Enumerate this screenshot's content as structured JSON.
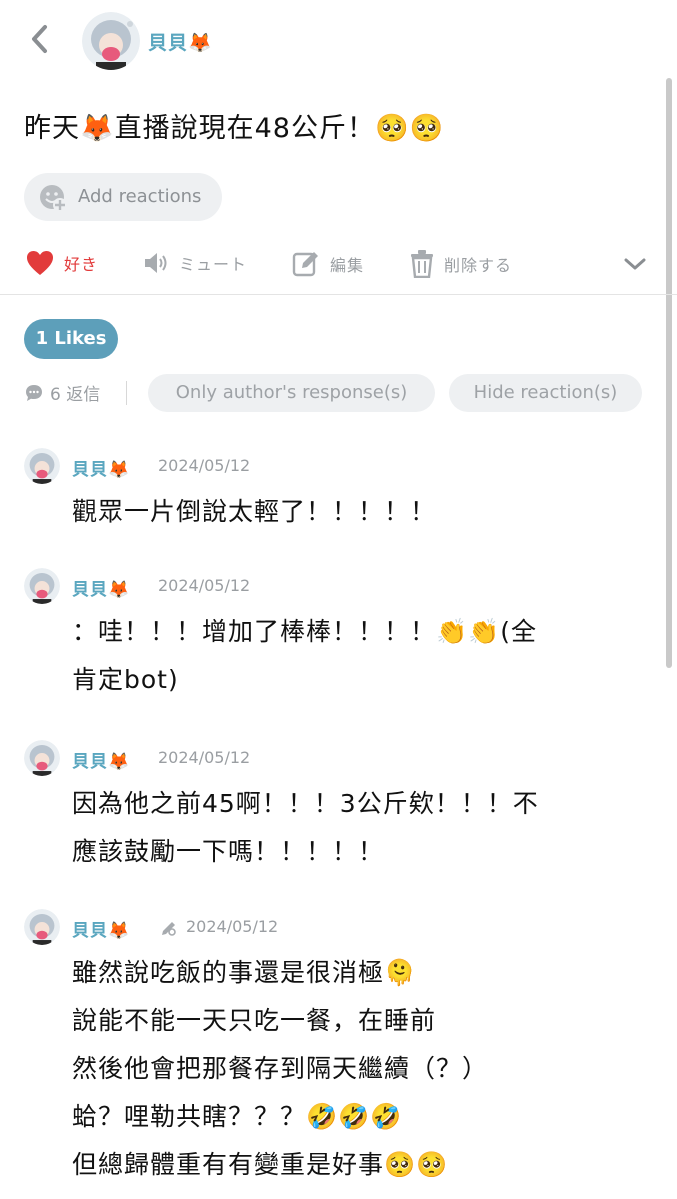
{
  "header": {
    "author_name": "貝貝🦊"
  },
  "post": {
    "text": "昨天🦊直播說現在48公斤！🥺🥺"
  },
  "reactions": {
    "add_label": "Add reactions"
  },
  "actions": {
    "like_label": "好き",
    "mute_label": "ミュート",
    "edit_label": "編集",
    "delete_label": "削除する",
    "like_color": "#e23b3b"
  },
  "likes": {
    "label": "1 Likes",
    "accent": "#5d9fba"
  },
  "filters": {
    "reply_count": "6 返信",
    "only_author": "Only author's response(s)",
    "hide_reaction": "Hide reaction(s)"
  },
  "comments": [
    {
      "name": "貝貝🦊",
      "date": "2024/05/12",
      "lines": [
        "觀眾一片倒說太輕了！！！！！"
      ]
    },
    {
      "name": "貝貝🦊",
      "date": "2024/05/12",
      "lines": [
        "：哇！！！增加了棒棒！！！！👏👏(全",
        "肯定bot)"
      ]
    },
    {
      "name": "貝貝🦊",
      "date": "2024/05/12",
      "lines": [
        "因為他之前45啊！！！3公斤欸！！！不",
        "應該鼓勵一下嗎！！！！！"
      ]
    },
    {
      "name": "貝貝🦊",
      "date": "2024/05/12",
      "edited_icon": "pencil-icon",
      "lines": [
        "雖然說吃飯的事還是很消極🫠",
        "說能不能一天只吃一餐，在睡前",
        "然後他會把那餐存到隔天繼續（？）",
        "蛤？哩勒共瞎？？？🤣🤣🤣",
        "但總歸體重有有變重是好事🥺🥺"
      ]
    }
  ]
}
